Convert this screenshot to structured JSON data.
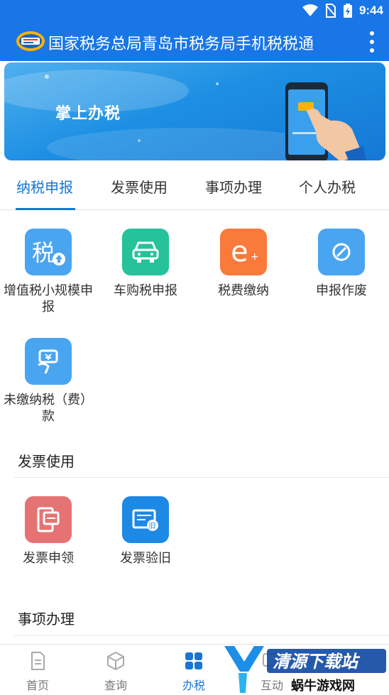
{
  "status_bar": {
    "time": "9:44"
  },
  "app_bar": {
    "title": "国家税务总局青岛市税务局手机税税通"
  },
  "banner": {
    "title": "掌上办税"
  },
  "tabs": [
    {
      "label": "纳税申报",
      "active": true
    },
    {
      "label": "发票使用",
      "active": false
    },
    {
      "label": "事项办理",
      "active": false
    },
    {
      "label": "个人办税",
      "active": false
    }
  ],
  "declaration": {
    "items": [
      {
        "label": "增值税小规模申报",
        "icon": "tax-upload-icon",
        "color": "#4aa5f0"
      },
      {
        "label": "车购税申报",
        "icon": "car-icon",
        "color": "#26c29a"
      },
      {
        "label": "税费缴纳",
        "icon": "e-pay-icon",
        "color": "#f97a3a"
      },
      {
        "label": "申报作废",
        "icon": "void-icon",
        "color": "#4aa5f0"
      },
      {
        "label": "未缴纳税（费）款",
        "icon": "hand-money-icon",
        "color": "#4aa5f0"
      }
    ]
  },
  "invoice_section": {
    "title": "发票使用",
    "items": [
      {
        "label": "发票申领",
        "icon": "invoice-apply-icon",
        "color": "#e57373"
      },
      {
        "label": "发票验旧",
        "icon": "invoice-check-icon",
        "color": "#1e88e5"
      }
    ]
  },
  "matters_section": {
    "title": "事项办理"
  },
  "bottom_nav": [
    {
      "label": "首页",
      "icon": "document-icon",
      "active": false
    },
    {
      "label": "查询",
      "icon": "cube-icon",
      "active": false
    },
    {
      "label": "办税",
      "icon": "grid-icon",
      "active": true
    },
    {
      "label": "互动",
      "icon": "chat-icon",
      "active": false
    }
  ],
  "watermark": {
    "text": "清源下载站",
    "subtext": "蜗牛游戏网"
  }
}
